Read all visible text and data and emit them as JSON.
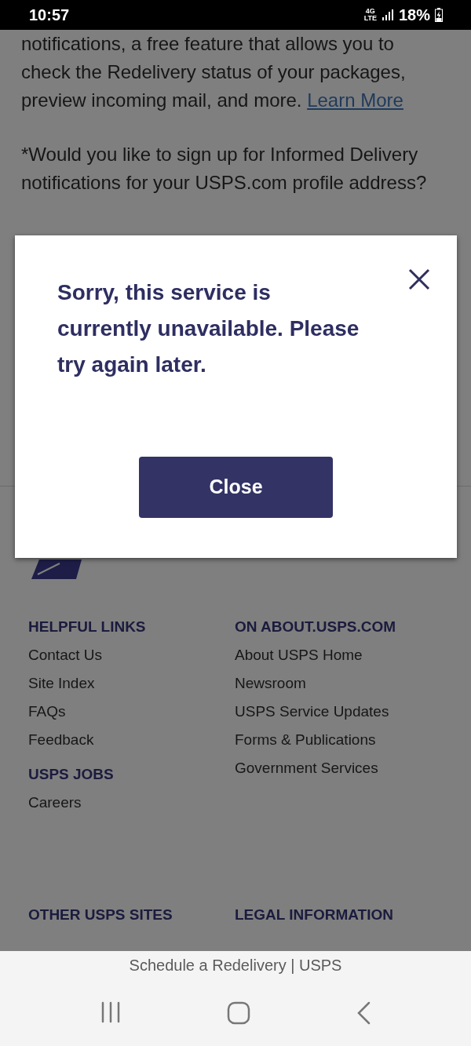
{
  "status_bar": {
    "time": "10:57",
    "network_top": "4G",
    "network_bottom": "LTE",
    "battery": "18%"
  },
  "page": {
    "intro_text": "notifications, a free feature that allows you to check the Redelivery status of your packages, preview incoming mail, and more.",
    "learn_more_link": "Learn More",
    "question": "*Would you like to sign up for Informed Delivery notifications for your USPS.com profile address?"
  },
  "footer": {
    "columns": [
      {
        "sections": [
          {
            "heading": "HELPFUL LINKS",
            "links": [
              "Contact Us",
              "Site Index",
              "FAQs",
              "Feedback"
            ]
          },
          {
            "heading": "USPS JOBS",
            "links": [
              "Careers"
            ]
          }
        ]
      },
      {
        "sections": [
          {
            "heading": "ON ABOUT.USPS.COM",
            "links": [
              "About USPS Home",
              "Newsroom",
              "USPS Service Updates",
              "Forms & Publications",
              "Government Services"
            ]
          }
        ]
      }
    ],
    "bottom_headings": [
      "OTHER USPS SITES",
      "LEGAL INFORMATION"
    ]
  },
  "dialog": {
    "message": "Sorry, this service is currently unavailable. Please try again later.",
    "button": "Close"
  },
  "browser": {
    "page_title": "Schedule a Redelivery | USPS"
  }
}
